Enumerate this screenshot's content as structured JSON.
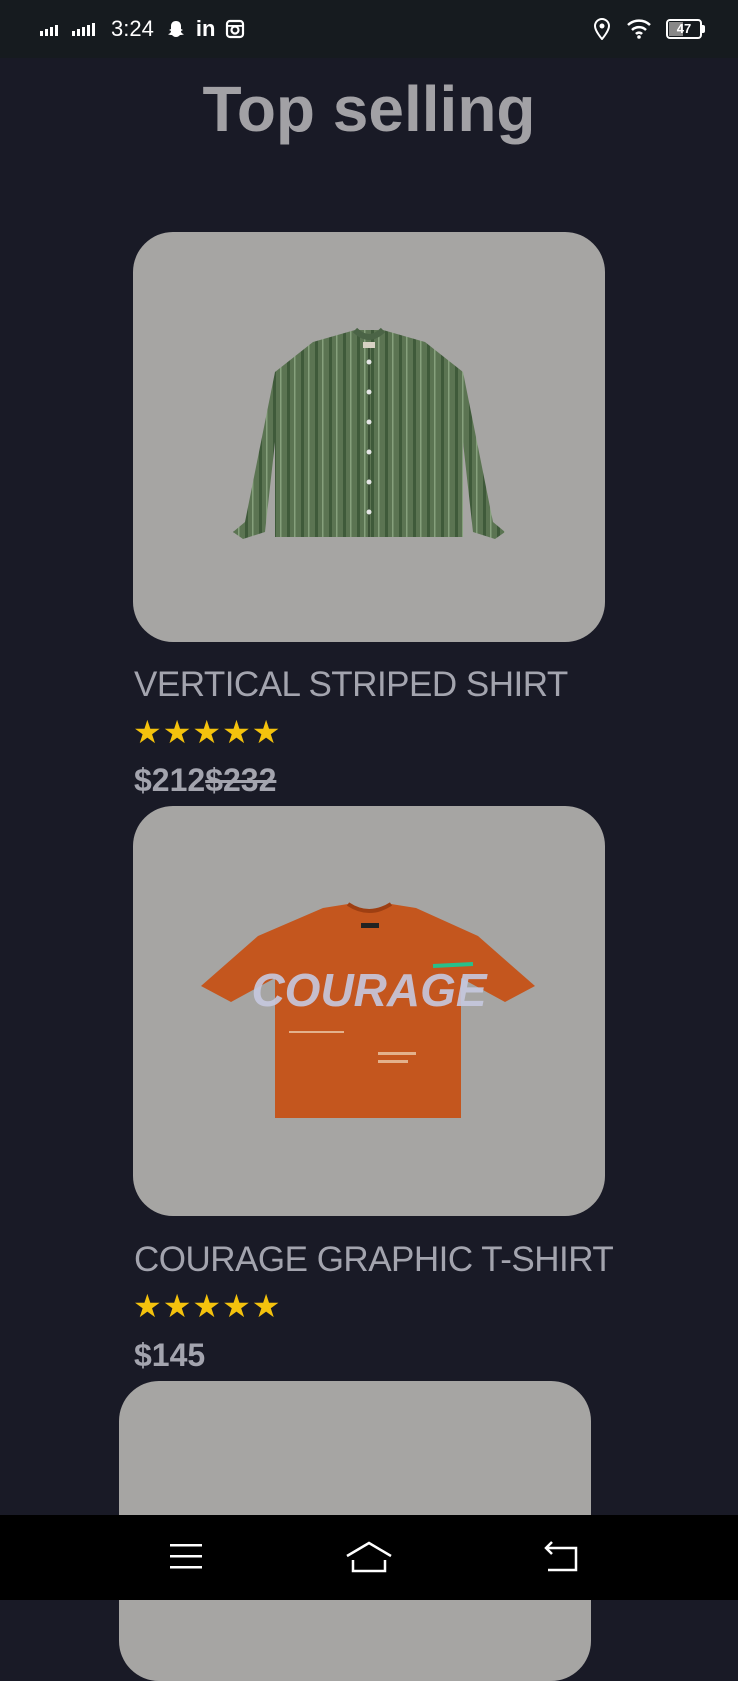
{
  "status_bar": {
    "time": "3:24",
    "linkedin": "in",
    "battery": "47",
    "icons": [
      "signal-icon",
      "signal-icon",
      "snapchat-icon",
      "linkedin-icon",
      "instagram-icon",
      "location-icon",
      "wifi-icon",
      "battery-icon"
    ]
  },
  "title": "Top selling",
  "products": [
    {
      "name": "VERTICAL STRIPED SHIRT",
      "stars": "★★★★★",
      "rating": 5,
      "price": "$212",
      "old_price": "$232"
    },
    {
      "name": "COURAGE GRAPHIC T-SHIRT",
      "stars": "★★★★★",
      "rating": 5,
      "price": "$145",
      "print_text": "COURAGE"
    }
  ],
  "nav_bar": {
    "icons": [
      "menu-icon",
      "home-icon",
      "back-icon"
    ]
  },
  "colors": {
    "background": "#191a26",
    "card": "#a6a5a3",
    "star": "#f4c20d",
    "text": "#a3a4ae"
  }
}
